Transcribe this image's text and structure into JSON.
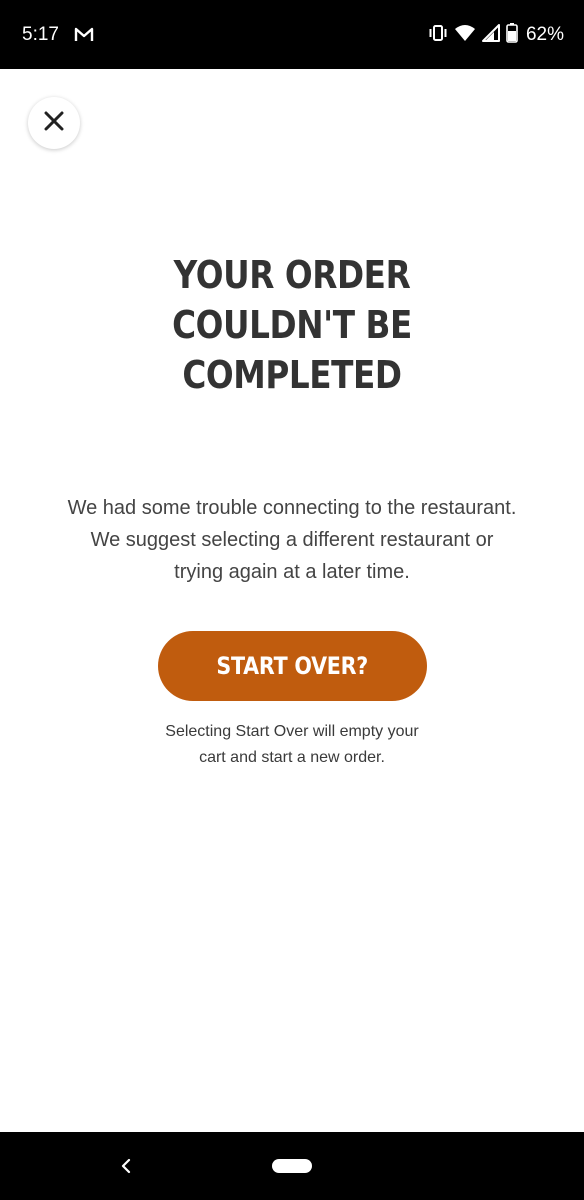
{
  "status_bar": {
    "time": "5:17",
    "notification_icon": "gmail-icon",
    "icons": [
      "vibrate-icon",
      "wifi-icon",
      "cell-signal-icon",
      "battery-icon"
    ],
    "battery_percent": "62%"
  },
  "dialog": {
    "close_icon": "close-icon",
    "title_lines": [
      "YOUR ORDER",
      "COULDN'T BE",
      "COMPLETED"
    ],
    "message_lines": [
      "We had some trouble connecting to the restaurant.",
      "We suggest selecting a different restaurant or",
      "trying again at a later time."
    ],
    "start_over_label": "START OVER?",
    "note_lines": [
      "Selecting Start Over will empty your",
      "cart and start a new order."
    ]
  },
  "nav_bar": {
    "back_icon": "back-chevron-icon",
    "home_icon": "home-pill-icon"
  },
  "colors": {
    "accent": "#c05c0e",
    "title": "#333333",
    "text": "#444444",
    "system_bar": "#000000"
  }
}
